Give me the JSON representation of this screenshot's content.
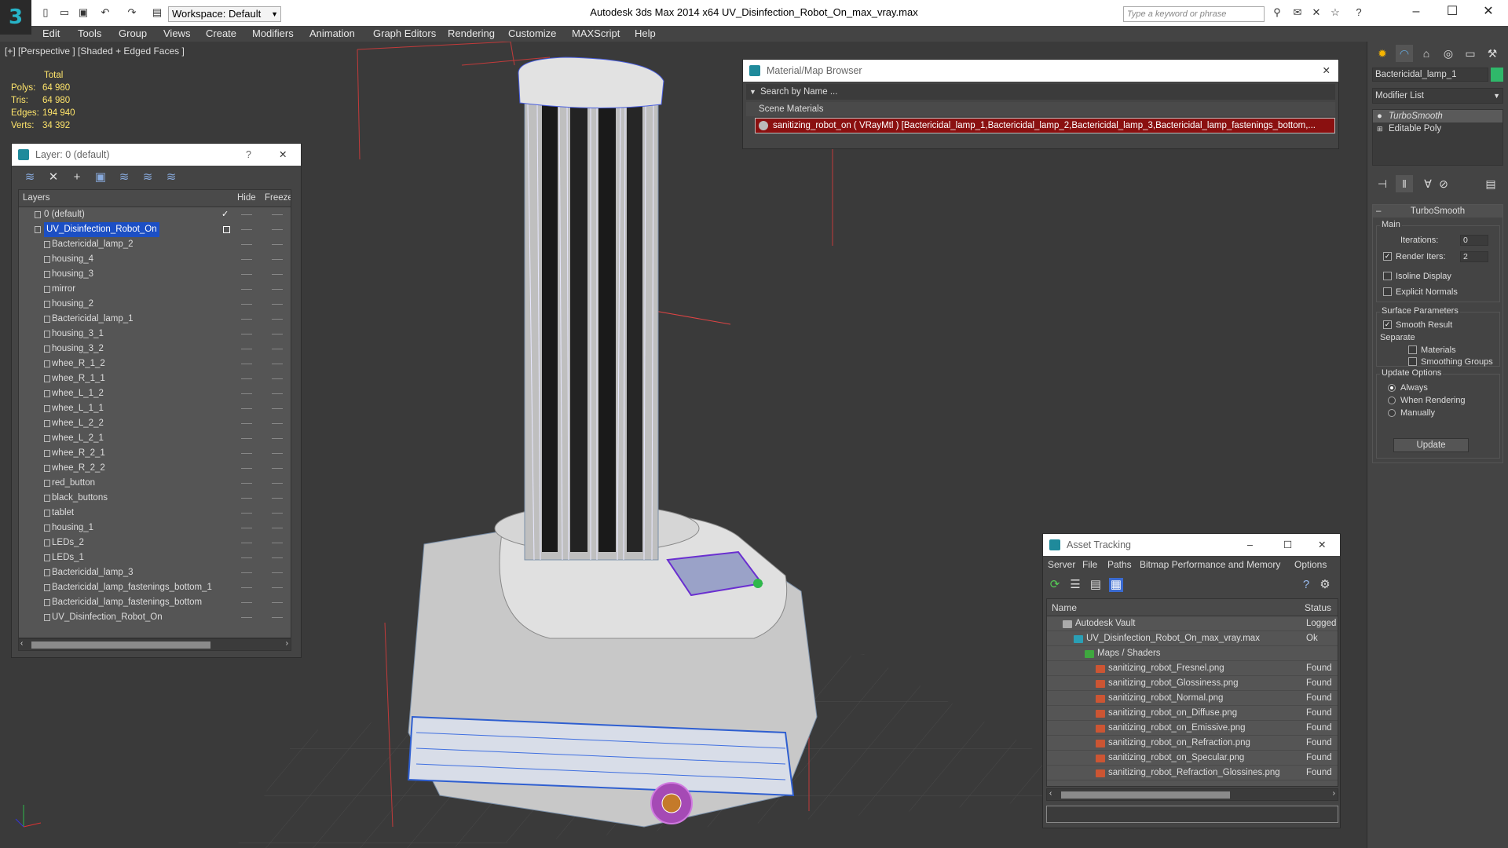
{
  "app": {
    "title": "Autodesk 3ds Max  2014 x64     UV_Disinfection_Robot_On_max_vray.max",
    "workspace": "Workspace: Default",
    "search_placeholder": "Type a keyword or phrase"
  },
  "menu": [
    "Edit",
    "Tools",
    "Group",
    "Views",
    "Create",
    "Modifiers",
    "Animation",
    "Graph Editors",
    "Rendering",
    "Customize",
    "MAXScript",
    "Help"
  ],
  "viewport": {
    "label": "[+] [Perspective ] [Shaded + Edged Faces ]",
    "stats": {
      "header": "Total",
      "rows": [
        {
          "label": "Polys:",
          "value": "64 980"
        },
        {
          "label": "Tris:",
          "value": "64 980"
        },
        {
          "label": "Edges:",
          "value": "194 940"
        },
        {
          "label": "Verts:",
          "value": "34 392"
        }
      ]
    }
  },
  "layer_panel": {
    "title": "Layer: 0 (default)",
    "help": "?",
    "columns": {
      "layers": "Layers",
      "hide": "Hide",
      "freeze": "Freeze"
    },
    "rows": [
      {
        "name": "0 (default)",
        "level": 0
      },
      {
        "name": "UV_Disinfection_Robot_On",
        "level": 0
      },
      {
        "name": "Bactericidal_lamp_2",
        "level": 1
      },
      {
        "name": "housing_4",
        "level": 1
      },
      {
        "name": "housing_3",
        "level": 1
      },
      {
        "name": "mirror",
        "level": 1
      },
      {
        "name": "housing_2",
        "level": 1
      },
      {
        "name": "Bactericidal_lamp_1",
        "level": 1
      },
      {
        "name": "housing_3_1",
        "level": 1
      },
      {
        "name": "housing_3_2",
        "level": 1
      },
      {
        "name": "whee_R_1_2",
        "level": 1
      },
      {
        "name": "whee_R_1_1",
        "level": 1
      },
      {
        "name": "whee_L_1_2",
        "level": 1
      },
      {
        "name": "whee_L_1_1",
        "level": 1
      },
      {
        "name": "whee_L_2_2",
        "level": 1
      },
      {
        "name": "whee_L_2_1",
        "level": 1
      },
      {
        "name": "whee_R_2_1",
        "level": 1
      },
      {
        "name": "whee_R_2_2",
        "level": 1
      },
      {
        "name": "red_button",
        "level": 1
      },
      {
        "name": "black_buttons",
        "level": 1
      },
      {
        "name": "tablet",
        "level": 1
      },
      {
        "name": "housing_1",
        "level": 1
      },
      {
        "name": "LEDs_2",
        "level": 1
      },
      {
        "name": "LEDs_1",
        "level": 1
      },
      {
        "name": "Bactericidal_lamp_3",
        "level": 1
      },
      {
        "name": "Bactericidal_lamp_fastenings_bottom_1",
        "level": 1
      },
      {
        "name": "Bactericidal_lamp_fastenings_bottom",
        "level": 1
      },
      {
        "name": "UV_Disinfection_Robot_On",
        "level": 1
      }
    ]
  },
  "material_browser": {
    "title": "Material/Map Browser",
    "search": "Search by Name ...",
    "section": "Scene Materials",
    "item": "sanitizing_robot_on ( VRayMtl ) [Bactericidal_lamp_1,Bactericidal_lamp_2,Bactericidal_lamp_3,Bactericidal_lamp_fastenings_bottom,..."
  },
  "asset_tracking": {
    "title": "Asset Tracking",
    "menu": [
      "Server",
      "File",
      "Paths",
      "Bitmap Performance and Memory",
      "Options"
    ],
    "columns": {
      "name": "Name",
      "status": "Status"
    },
    "rows": [
      {
        "name": "Autodesk Vault",
        "status": "Logged",
        "indent": 1,
        "kind": "vault"
      },
      {
        "name": "UV_Disinfection_Robot_On_max_vray.max",
        "status": "Ok",
        "indent": 2,
        "kind": "max"
      },
      {
        "name": "Maps / Shaders",
        "status": "",
        "indent": 3,
        "kind": "folder"
      },
      {
        "name": "sanitizing_robot_Fresnel.png",
        "status": "Found",
        "indent": 4,
        "kind": "png"
      },
      {
        "name": "sanitizing_robot_Glossiness.png",
        "status": "Found",
        "indent": 4,
        "kind": "png"
      },
      {
        "name": "sanitizing_robot_Normal.png",
        "status": "Found",
        "indent": 4,
        "kind": "png"
      },
      {
        "name": "sanitizing_robot_on_Diffuse.png",
        "status": "Found",
        "indent": 4,
        "kind": "png"
      },
      {
        "name": "sanitizing_robot_on_Emissive.png",
        "status": "Found",
        "indent": 4,
        "kind": "png"
      },
      {
        "name": "sanitizing_robot_on_Refraction.png",
        "status": "Found",
        "indent": 4,
        "kind": "png"
      },
      {
        "name": "sanitizing_robot_on_Specular.png",
        "status": "Found",
        "indent": 4,
        "kind": "png"
      },
      {
        "name": "sanitizing_robot_Refraction_Glossines.png",
        "status": "Found",
        "indent": 4,
        "kind": "png"
      }
    ]
  },
  "command_panel": {
    "object_name": "Bactericidal_lamp_1",
    "modifier_list": "Modifier List",
    "stack": [
      "TurboSmooth",
      "Editable Poly"
    ],
    "turbosmooth": {
      "header": "TurboSmooth",
      "main": "Main",
      "iterations_label": "Iterations:",
      "iterations": "0",
      "render_iters_label": "Render Iters:",
      "render_iters": "2",
      "isoline": "Isoline Display",
      "explicit_normals": "Explicit Normals",
      "surface_params": "Surface Parameters",
      "smooth_result": "Smooth Result",
      "separate": "Separate",
      "materials": "Materials",
      "smoothing_groups": "Smoothing Groups",
      "update_options": "Update Options",
      "always": "Always",
      "when_rendering": "When Rendering",
      "manually": "Manually",
      "update": "Update"
    }
  }
}
